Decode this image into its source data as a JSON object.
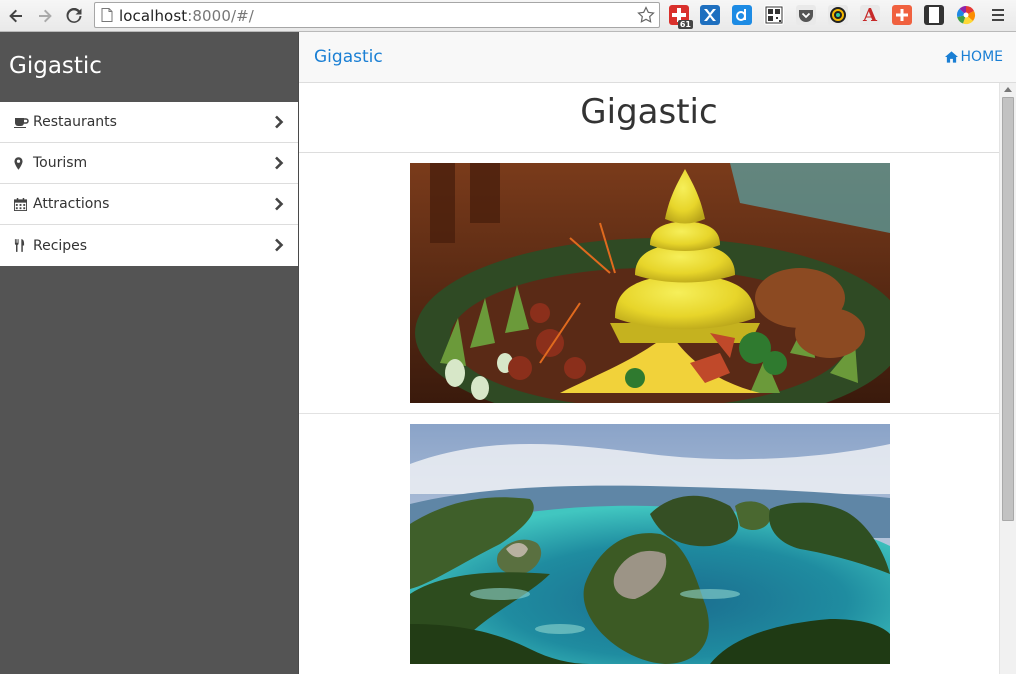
{
  "browser": {
    "url_host": "localhost",
    "url_rest": ":8000/#/",
    "extension_badge": "61"
  },
  "sidebar": {
    "title": "Gigastic",
    "items": [
      {
        "label": "Restaurants",
        "icon": "coffee-icon"
      },
      {
        "label": "Tourism",
        "icon": "map-marker-icon"
      },
      {
        "label": "Attractions",
        "icon": "calendar-icon"
      },
      {
        "label": "Recipes",
        "icon": "cutlery-icon"
      }
    ]
  },
  "header": {
    "brand": "Gigastic",
    "home_label": "HOME"
  },
  "main": {
    "title": "Gigastic",
    "cards": [
      {
        "image": "yellow-rice-cone-dish-photo"
      },
      {
        "image": "tropical-islands-lagoon-photo"
      }
    ]
  },
  "colors": {
    "sidebar_bg": "#545454",
    "link": "#1a7fd4",
    "topbar_bg": "#f8f8f8"
  }
}
